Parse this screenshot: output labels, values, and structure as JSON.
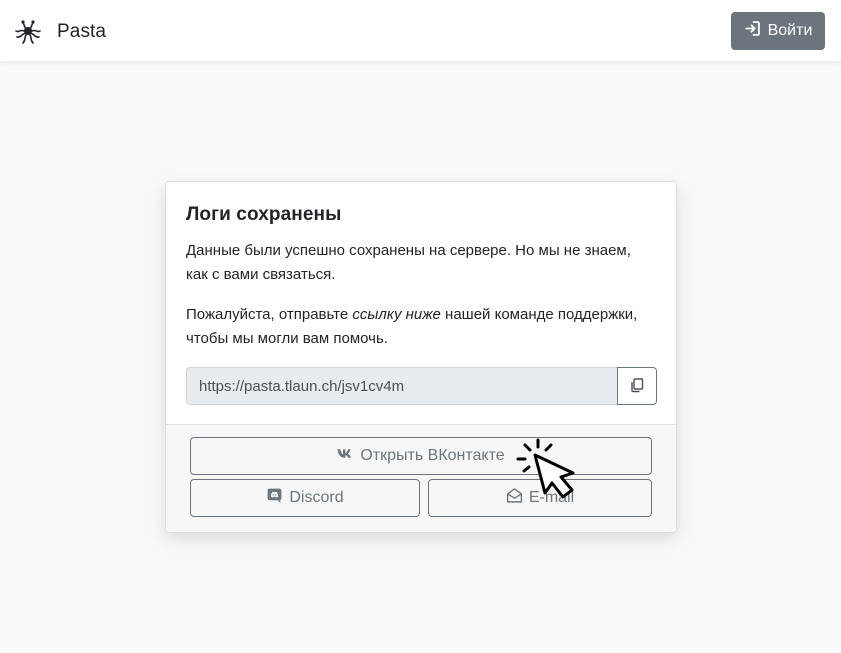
{
  "navbar": {
    "brand_name": "Pasta",
    "brand_icon": "flying-spaghetti-monster-icon",
    "login_label": "Войти",
    "login_icon": "sign-in-icon"
  },
  "card": {
    "title": "Логи сохранены",
    "paragraph1": "Данные были успешно сохранены на сервере. Но мы не знаем, как с вами связаться.",
    "paragraph2_before": "Пожалуйста, отправьте ",
    "paragraph2_emphasis": "ссылку ниже",
    "paragraph2_after": " нашей команде поддержки, чтобы мы могли вам помочь.",
    "link_value": "https://pasta.tlaun.ch/jsv1cv4m",
    "copy_icon": "copy-icon"
  },
  "footer": {
    "vk_label": "Открыть ВКонтакте",
    "discord_label": "Discord",
    "email_label": "E-mail"
  },
  "colors": {
    "secondary": "#6c757d",
    "background": "#f8f9fa",
    "input_bg": "#e9ecef"
  }
}
